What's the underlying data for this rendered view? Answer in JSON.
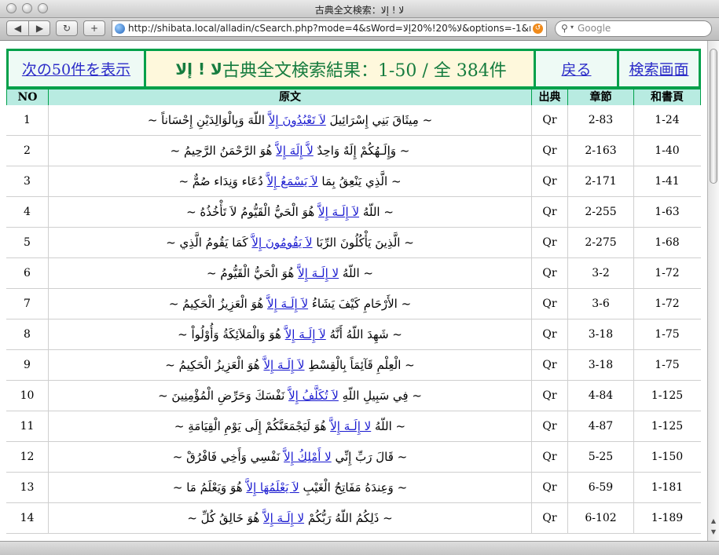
{
  "window": {
    "title": "古典全文検索：لا ! إلا"
  },
  "toolbar": {
    "url": "http://shibata.local/alladin/cSearch.php?mode=4&sWord=لا%20!%20إلا&options=-1&rou",
    "search_placeholder": "Google",
    "back_glyph": "◀",
    "forward_glyph": "▶",
    "reload_glyph": "↻",
    "add_glyph": "+"
  },
  "header": {
    "next_link": "次の50件を表示",
    "title_prefix": "古典全文検索結果：1-50 / 全 384件",
    "title_arabic": "لا ! إلا",
    "back_link": "戻る",
    "search_link": "検索画面"
  },
  "table": {
    "columns": [
      "NO",
      "原文",
      "出典",
      "章節",
      "和書頁"
    ],
    "rows": [
      {
        "no": "1",
        "pre": "~ مِيثَاقَ بَنِي إِسْرَائِيلَ",
        "kw": "لاَ تَعْبُدُونَ إِلاَّ",
        "post": "اللّهَ وَبِالْوَالِدَيْنِ إِحْسَاناً ~",
        "src": "Qr",
        "ch": "2-83",
        "page": "1-24"
      },
      {
        "no": "2",
        "pre": "~ وَإِلَـهُكُمْ إِلَهٌ وَاحِدٌ",
        "kw": "لاَّ إِلَهَ إِلاَّ",
        "post": "هُوَ الرَّحْمَنُ الرَّحِيمُ ~",
        "src": "Qr",
        "ch": "2-163",
        "page": "1-40"
      },
      {
        "no": "3",
        "pre": "~ الَّذِي يَنْعِقُ بِمَا",
        "kw": "لاَ يَسْمَعُ إِلاَّ",
        "post": "دُعَاء وَنِدَاء صُمٌّ ~",
        "src": "Qr",
        "ch": "2-171",
        "page": "1-41"
      },
      {
        "no": "4",
        "pre": "~ اللّهُ",
        "kw": "لاَ إِلَـهَ إِلاَّ",
        "post": "هُوَ الْحَيُّ الْقَيُّومُ لاَ تَأْخُذُهُ ~",
        "src": "Qr",
        "ch": "2-255",
        "page": "1-63"
      },
      {
        "no": "5",
        "pre": "~ الَّذِينَ يَأْكُلُونَ الرِّبَا",
        "kw": "لاَ يَقُومُونَ إِلاَّ",
        "post": "كَمَا يَقُومُ الَّذِي ~",
        "src": "Qr",
        "ch": "2-275",
        "page": "1-68"
      },
      {
        "no": "6",
        "pre": "~ اللّهُ",
        "kw": "لا إِلَـهَ إِلاَّ",
        "post": "هُوَ الْحَيُّ الْقَيُّومُ ~",
        "src": "Qr",
        "ch": "3-2",
        "page": "1-72"
      },
      {
        "no": "7",
        "pre": "~ الأَرْحَامِ كَيْفَ يَشَاءُ",
        "kw": "لاَ إِلَـهَ إِلاَّ",
        "post": "هُوَ الْعَزِيزُ الْحَكِيمُ ~",
        "src": "Qr",
        "ch": "3-6",
        "page": "1-72"
      },
      {
        "no": "8",
        "pre": "~ شَهِدَ اللّهُ أَنَّهُ",
        "kw": "لاَ إِلَـهَ إِلاَّ",
        "post": "هُوَ وَالْمَلاَئِكَةُ وَأُوْلُواْ ~",
        "src": "Qr",
        "ch": "3-18",
        "page": "1-75"
      },
      {
        "no": "9",
        "pre": "~ الْعِلْمِ قَآئِمَاً بِالْقِسْطِ",
        "kw": "لاَ إِلَـهَ إِلاَّ",
        "post": "هُوَ الْعَزِيزُ الْحَكِيمُ ~",
        "src": "Qr",
        "ch": "3-18",
        "page": "1-75"
      },
      {
        "no": "10",
        "pre": "~ فِي سَبِيلِ اللّهِ",
        "kw": "لاَ تُكَلَّفُ إِلاَّ",
        "post": "نَفْسَكَ وَحَرِّضِ الْمُؤْمِنِينَ ~",
        "src": "Qr",
        "ch": "4-84",
        "page": "1-125"
      },
      {
        "no": "11",
        "pre": "~ اللّهُ",
        "kw": "لا إِلَـهَ إِلاَّ",
        "post": "هُوَ لَيَجْمَعَنَّكُمْ إِلَى يَوْمِ الْقِيَامَةِ ~",
        "src": "Qr",
        "ch": "4-87",
        "page": "1-125"
      },
      {
        "no": "12",
        "pre": "~ قَالَ رَبِّ إِنِّي",
        "kw": "لا أَمْلِكُ إِلاَّ",
        "post": "نَفْسِي وَأَخِي فَافْرُقْ ~",
        "src": "Qr",
        "ch": "5-25",
        "page": "1-150"
      },
      {
        "no": "13",
        "pre": "~ وَعِندَهُ مَفَاتِحُ الْغَيْبِ",
        "kw": "لاَ يَعْلَمُهَا إِلاَّ",
        "post": "هُوَ وَيَعْلَمُ مَا ~",
        "src": "Qr",
        "ch": "6-59",
        "page": "1-181"
      },
      {
        "no": "14",
        "pre": "~ ذَلِكُمُ اللّهُ رَبُّكُمْ",
        "kw": "لا إِلَـهَ إِلاَّ",
        "post": "هُوَ خَالِقُ كُلِّ ~",
        "src": "Qr",
        "ch": "6-102",
        "page": "1-189"
      }
    ]
  }
}
